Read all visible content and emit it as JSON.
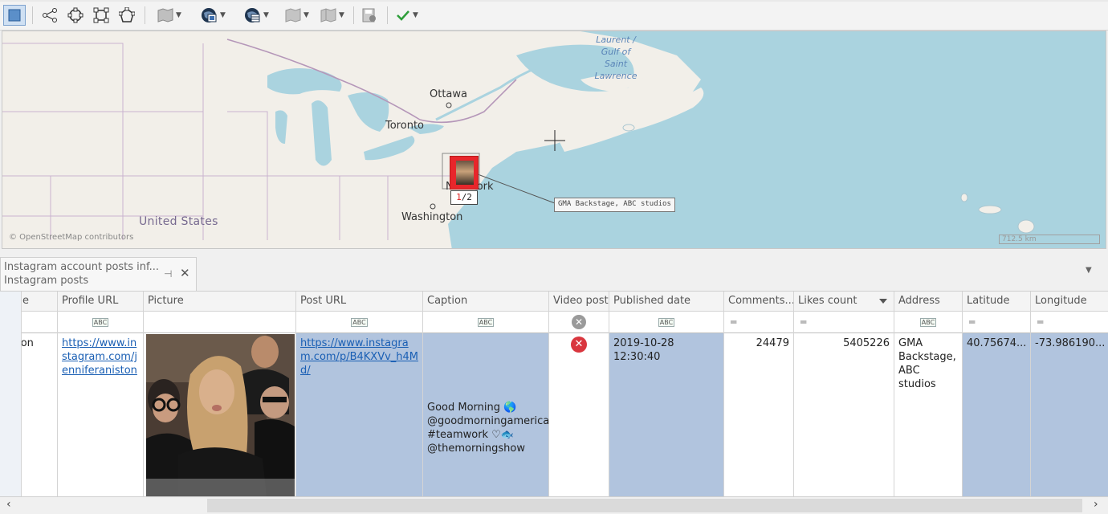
{
  "toolbar": {
    "buttons": [
      "select",
      "connect",
      "circle-select",
      "rect-select",
      "polygon-select",
      "map-layers",
      "globe-photos",
      "globe-data",
      "map-view",
      "map-layout",
      "save-map",
      "apply"
    ],
    "apply_color": "#2e9e3a"
  },
  "map": {
    "labels": {
      "ottawa": "Ottawa",
      "toronto": "Toronto",
      "washington": "Washington",
      "new_york": "New York",
      "united_states": "United States",
      "gulf_line1": "Laurent /",
      "gulf_line2": "Gulf of",
      "gulf_line3": "Saint",
      "gulf_line4": "Lawrence"
    },
    "attribution": "© OpenStreetMap contributors",
    "scale": "712.5 km",
    "geo_label": "GMA Backstage, ABC studios",
    "marker_count_current": "1",
    "marker_count_total": "/2",
    "water_color": "#aad3df",
    "land_color": "#f2efe9",
    "marker_color": "#e8262b"
  },
  "panel": {
    "tab_title": "Instagram account posts inf...",
    "tab_subtitle": "Instagram posts"
  },
  "grid": {
    "columns": {
      "name": "e",
      "profile_url": "Profile URL",
      "picture": "Picture",
      "post_url": "Post URL",
      "caption": "Caption",
      "video_post": "Video post",
      "published_date": "Published date",
      "comments": "Comments...",
      "likes": "Likes count",
      "address": "Address",
      "latitude": "Latitude",
      "longitude": "Longitude"
    },
    "row": {
      "name": "niston",
      "profile_url": "https://www.instagram.com/jenniferaniston",
      "post_url": "https://www.instagram.com/p/B4KXVv_h4Md/",
      "caption": "Good Morning 🌎 @goodmorningamerica #teamwork ♡🐟 @themorningshow",
      "video_post": false,
      "published_date": "2019-10-28 12:30:40",
      "comments": "24479",
      "likes": "5405226",
      "address": "GMA Backstage, ABC studios",
      "latitude": "40.75674...",
      "longitude": "-73.986190..."
    },
    "selected_color": "#b1c4de"
  }
}
